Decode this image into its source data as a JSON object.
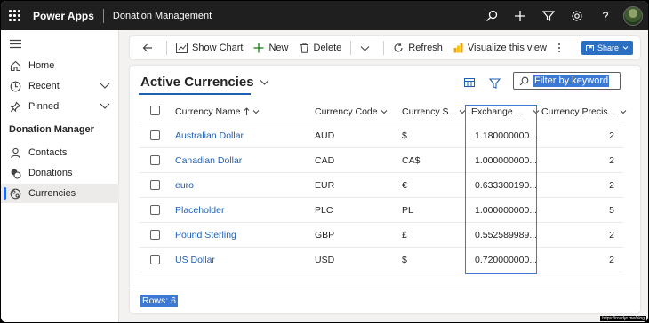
{
  "topbar": {
    "app_name": "Power Apps",
    "app_title": "Donation Management"
  },
  "sidebar": {
    "items": [
      {
        "label": "Home"
      },
      {
        "label": "Recent"
      },
      {
        "label": "Pinned"
      }
    ],
    "group_title": "Donation Manager",
    "group_items": [
      {
        "label": "Contacts"
      },
      {
        "label": "Donations"
      },
      {
        "label": "Currencies",
        "selected": true
      }
    ]
  },
  "commandbar": {
    "show_chart": "Show Chart",
    "new": "New",
    "delete": "Delete",
    "refresh": "Refresh",
    "visualize": "Visualize this view",
    "share": "Share"
  },
  "view": {
    "title": "Active Currencies",
    "filter_placeholder": "Filter by keyword"
  },
  "grid": {
    "columns": [
      "Currency Name",
      "Currency Code",
      "Currency S...",
      "Exchange ...",
      "Currency Precis..."
    ],
    "rows": [
      {
        "name": "Australian Dollar",
        "code": "AUD",
        "symbol": "$",
        "rate": "1.180000000...",
        "precision": "2"
      },
      {
        "name": "Canadian Dollar",
        "code": "CAD",
        "symbol": "CA$",
        "rate": "1.000000000...",
        "precision": "2"
      },
      {
        "name": "euro",
        "code": "EUR",
        "symbol": "€",
        "rate": "0.633300190...",
        "precision": "2"
      },
      {
        "name": "Placeholder",
        "code": "PLC",
        "symbol": "PL",
        "rate": "1.000000000...",
        "precision": "5"
      },
      {
        "name": "Pound Sterling",
        "code": "GBP",
        "symbol": "£",
        "rate": "0.552589989...",
        "precision": "2"
      },
      {
        "name": "US Dollar",
        "code": "USD",
        "symbol": "$",
        "rate": "0.720000000...",
        "precision": "2"
      }
    ]
  },
  "footer": {
    "rows_label": "Rows: 6"
  },
  "watermark": "https://rozdyr.me/blog",
  "colors": {
    "accent": "#1f5fb3",
    "selection": "#3c79d4",
    "topbar": "#1f1f1f"
  }
}
